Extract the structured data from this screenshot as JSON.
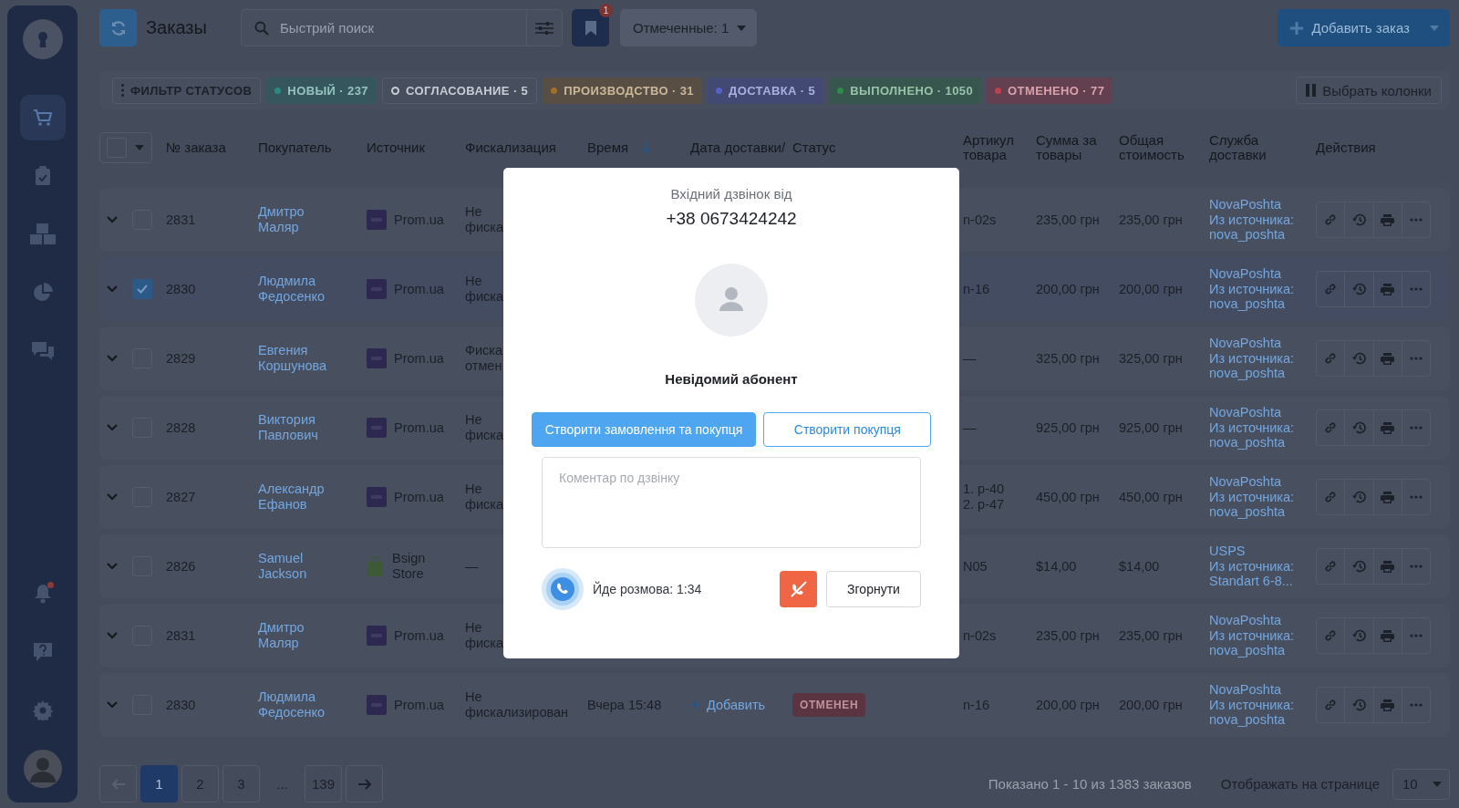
{
  "sidebar": {
    "items": [
      {
        "kind": "cart",
        "selected": true,
        "alert": false
      },
      {
        "kind": "clipboard",
        "selected": false,
        "alert": false
      },
      {
        "kind": "boxes",
        "selected": false,
        "alert": false
      },
      {
        "kind": "pie",
        "selected": false,
        "alert": false
      },
      {
        "kind": "chat",
        "selected": false,
        "alert": false
      }
    ],
    "bottom": [
      {
        "kind": "bell",
        "selected": false,
        "alert": true
      },
      {
        "kind": "help",
        "selected": false,
        "alert": false
      },
      {
        "kind": "gear",
        "selected": false,
        "alert": false
      },
      {
        "kind": "avatar",
        "selected": false,
        "alert": false
      }
    ]
  },
  "header": {
    "title": "Заказы",
    "search": {
      "placeholder": "Быстрий поиск"
    },
    "bookmark_badge": "1",
    "marked": "Отмеченные: 1",
    "add_button": "Добавить заказ"
  },
  "filter": {
    "label": "ФИЛЬТР СТАТУСОВ",
    "statuses": [
      {
        "label": "НОВЫЙ · 237",
        "color": "#2a8a80",
        "outlined": false
      },
      {
        "label": "СОГЛАСОВАНИЕ · 5",
        "color": "#c8ccd4",
        "outlined": true
      },
      {
        "label": "ПРОИЗВОДСТВО · 31",
        "color": "#a0702a",
        "outlined": false
      },
      {
        "label": "ДОСТАВКА · 5",
        "color": "#5560c8",
        "outlined": false
      },
      {
        "label": "ВЫПОЛНЕНО · 1050",
        "color": "#2f8a4a",
        "outlined": false
      },
      {
        "label": "ОТМЕНЕНО · 77",
        "color": "#c04050",
        "outlined": false
      }
    ],
    "columns_button": "Выбрать колонки"
  },
  "table": {
    "select_all": false,
    "columns": [
      {
        "label": "№ заказа",
        "sorted": false
      },
      {
        "label": "Покупатель",
        "sorted": false
      },
      {
        "label": "Источник",
        "sorted": false
      },
      {
        "label": "Фискализация",
        "sorted": false
      },
      {
        "label": "Время",
        "sorted": true
      },
      {
        "label": "Дата доставки/",
        "sorted": false
      },
      {
        "label": "Статус",
        "sorted": false
      },
      {
        "label": "Артикул товара",
        "sorted": false
      },
      {
        "label": "Сумма за товары",
        "sorted": false
      },
      {
        "label": "Общая стоимость",
        "sorted": false
      },
      {
        "label": "Служба доставки",
        "sorted": false
      },
      {
        "label": "Действия",
        "sorted": false
      }
    ],
    "rows": [
      {
        "checked": false,
        "number": "2831",
        "buyer": "Дмитро Маляр",
        "source": {
          "kind": "prom",
          "name": "Prom.ua"
        },
        "fiscal": "Не фиска",
        "article": [
          "n-02s"
        ],
        "sum": "235,00 грн",
        "total": "235,00 грн",
        "service": "NovaPoshta",
        "service_source": "Из источника: nova_poshta"
      },
      {
        "checked": true,
        "number": "2830",
        "buyer": "Людмила Федосенко",
        "source": {
          "kind": "prom",
          "name": "Prom.ua"
        },
        "fiscal": "Не фиска",
        "article": [
          "n-16"
        ],
        "sum": "200,00 грн",
        "total": "200,00 грн",
        "service": "NovaPoshta",
        "service_source": "Из источника: nova_poshta"
      },
      {
        "checked": false,
        "number": "2829",
        "buyer": "Евгения Коршунова",
        "source": {
          "kind": "prom",
          "name": "Prom.ua"
        },
        "fiscal": "Фиска отмен",
        "article": [
          "—"
        ],
        "sum": "325,00 грн",
        "total": "325,00 грн",
        "service": "NovaPoshta",
        "service_source": "Из источника: nova_poshta"
      },
      {
        "checked": false,
        "number": "2828",
        "buyer": "Виктория Павлович",
        "source": {
          "kind": "prom",
          "name": "Prom.ua"
        },
        "fiscal": "Не фиска",
        "article": [
          "—"
        ],
        "sum": "925,00 грн",
        "total": "925,00 грн",
        "service": "NovaPoshta",
        "service_source": "Из источника: nova_poshta"
      },
      {
        "checked": false,
        "number": "2827",
        "buyer": "Александр Ефанов",
        "source": {
          "kind": "prom",
          "name": "Prom.ua"
        },
        "fiscal": "Не фиска",
        "article": [
          "1. p-40",
          "2. p-47"
        ],
        "sum": "450,00 грн",
        "total": "450,00 грн",
        "service": "NovaPoshta",
        "service_source": "Из источника: nova_poshta"
      },
      {
        "checked": false,
        "number": "2826",
        "buyer": "Samuel Jackson",
        "source": {
          "kind": "shop",
          "name": "Bsign Store"
        },
        "fiscal": "—",
        "article": [
          "N05"
        ],
        "sum": "$14,00",
        "total": "$14,00",
        "service": "USPS",
        "service_source": "Из источника: Standart 6-8..."
      },
      {
        "checked": false,
        "number": "2831",
        "buyer": "Дмитро Маляр",
        "source": {
          "kind": "prom",
          "name": "Prom.ua"
        },
        "fiscal": "Не фиска",
        "article": [
          "n-02s"
        ],
        "sum": "235,00 грн",
        "total": "235,00 грн",
        "service": "NovaPoshta",
        "service_source": "Из источника: nova_poshta"
      },
      {
        "checked": false,
        "number": "2830",
        "buyer": "Людмила Федосенко",
        "source": {
          "kind": "prom",
          "name": "Prom.ua"
        },
        "fiscal": "Не фискализирован",
        "time": "Вчера 15:48",
        "delivery_link": "Добавить",
        "status": {
          "label": "ОТМЕНЕН",
          "color": "#5a3440"
        },
        "article": [
          "n-16"
        ],
        "sum": "200,00 грн",
        "total": "200,00 грн",
        "service": "NovaPoshta",
        "service_source": "Из источника: nova_poshta"
      }
    ]
  },
  "pagination": {
    "prev_disabled": true,
    "next_disabled": false,
    "pages": [
      {
        "kind": "page",
        "label": "1",
        "selected": true
      },
      {
        "kind": "page",
        "label": "2",
        "selected": false
      },
      {
        "kind": "page",
        "label": "3",
        "selected": false
      },
      {
        "kind": "ellipsis",
        "label": "...",
        "selected": false
      },
      {
        "kind": "page",
        "label": "139",
        "selected": false
      }
    ],
    "info": "Показано 1 - 10 из 1383 заказов",
    "per_page_label": "Отображать на странице",
    "per_page": "10"
  },
  "call_dialog": {
    "caption": "Вхідний дзвінок від",
    "phone": "+38 0673424242",
    "caller": "Невідомий абонент",
    "buttons": [
      {
        "label": "Створити замовлення та покупця",
        "primary": true
      },
      {
        "label": "Створити покупця",
        "primary": false
      }
    ],
    "comment": {
      "placeholder": "Коментар по дзвінку"
    },
    "call_status": "Йде розмова: 1:34",
    "collapse_button": "Згорнути"
  }
}
